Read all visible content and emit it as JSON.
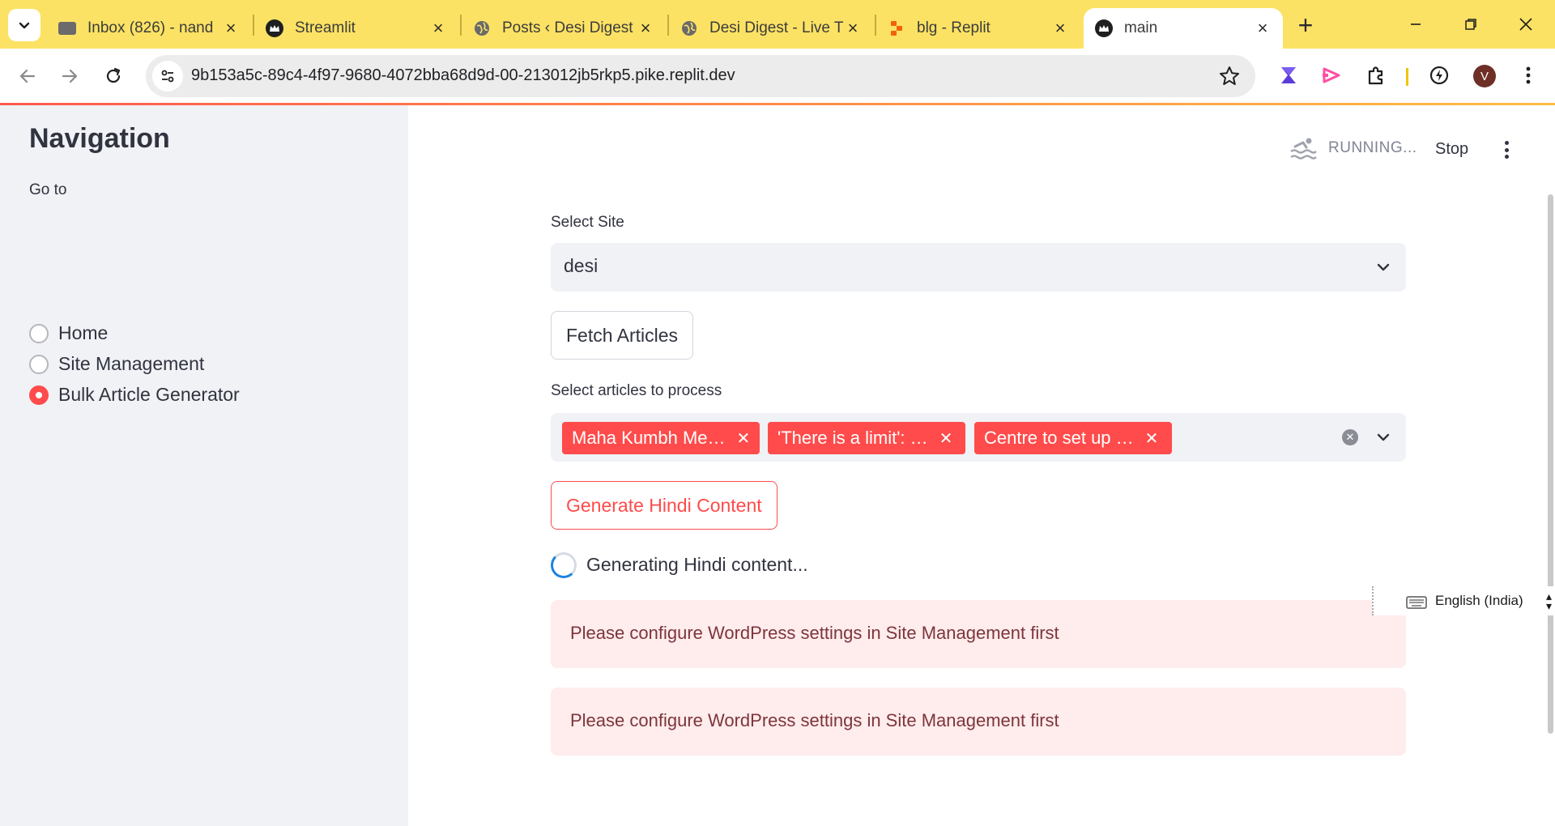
{
  "browser": {
    "tabs": [
      {
        "title": "Inbox (826) - nand",
        "favicon": "mail-icon",
        "active": false
      },
      {
        "title": "Streamlit",
        "favicon": "streamlit-crown-icon",
        "active": false
      },
      {
        "title": "Posts ‹ Desi Digest",
        "favicon": "globe-icon",
        "active": false
      },
      {
        "title": "Desi Digest - Live T",
        "favicon": "globe-icon",
        "active": false
      },
      {
        "title": "blg - Replit",
        "favicon": "replit-icon",
        "active": false
      },
      {
        "title": "main",
        "favicon": "streamlit-crown-icon",
        "active": true
      }
    ],
    "url": "9b153a5c-89c4-4f97-9680-4072bba68d9d-00-213012jb5rkp5.pike.replit.dev",
    "profile_initial": "V",
    "accent_color": "#fce264"
  },
  "sidebar": {
    "title": "Navigation",
    "radio_label": "Go to",
    "options": [
      {
        "label": "Home",
        "selected": false
      },
      {
        "label": "Site Management",
        "selected": false
      },
      {
        "label": "Bulk Article Generator",
        "selected": true
      }
    ]
  },
  "header": {
    "status": "RUNNING...",
    "stop_label": "Stop"
  },
  "main": {
    "site_select": {
      "label": "Select Site",
      "value": "desi"
    },
    "fetch_button": "Fetch Articles",
    "articles_select": {
      "label": "Select articles to process",
      "chips": [
        "Maha Kumbh Me…",
        "'There is a limit': …",
        "Centre to set up …"
      ]
    },
    "generate_button": "Generate Hindi Content",
    "spinner_text": "Generating Hindi content...",
    "alerts": [
      "Please configure WordPress settings in Site Management first",
      "Please configure WordPress settings in Site Management first"
    ],
    "accent_color": "#ff4b4b"
  },
  "ime": {
    "language": "English (India)"
  }
}
